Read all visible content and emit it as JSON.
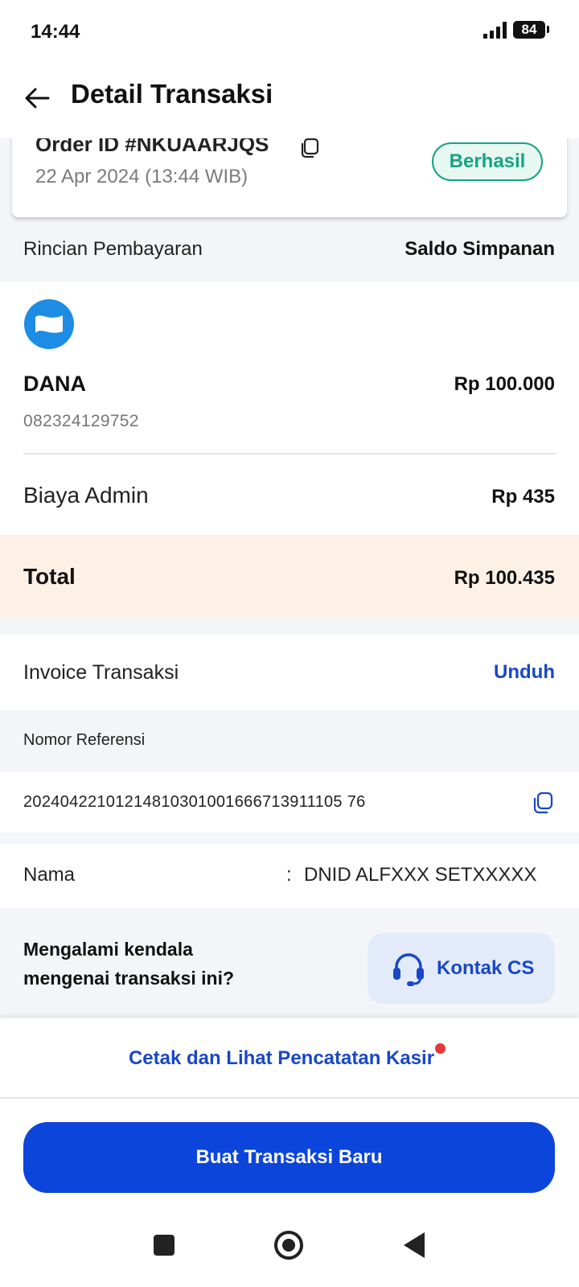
{
  "status_bar": {
    "time": "14:44",
    "battery": "84"
  },
  "header": {
    "title": "Detail Transaksi"
  },
  "order": {
    "id_label": "Order ID #NKUAARJQS",
    "date": "22 Apr 2024 (13:44 WIB)",
    "status": "Berhasil"
  },
  "payment": {
    "section_label": "Rincian Pembayaran",
    "method": "Saldo Simpanan",
    "provider": "DANA",
    "amount": "Rp 100.000",
    "phone": "082324129752",
    "admin_label": "Biaya Admin",
    "admin_value": "Rp 435",
    "total_label": "Total",
    "total_value": "Rp 100.435"
  },
  "invoice": {
    "label": "Invoice Transaksi",
    "action": "Unduh"
  },
  "reference": {
    "label": "Nomor Referensi",
    "value": "20240422101214810301001666713911105 76"
  },
  "customer": {
    "label": "Nama",
    "colon": ":",
    "value": "DNID ALFXXX SETXXXXX"
  },
  "help": {
    "text": "Mengalami kendala mengenai transaksi ini?",
    "button": "Kontak CS"
  },
  "bottom": {
    "cetak_link": "Cetak dan Lihat Pencatatan Kasir",
    "primary_button": "Buat Transaksi Baru"
  },
  "colors": {
    "primary": "#0c45dc",
    "link": "#1847c7",
    "success": "#13a584",
    "total_bg": "#fdf1e6",
    "dana": "#1c8ce4"
  }
}
